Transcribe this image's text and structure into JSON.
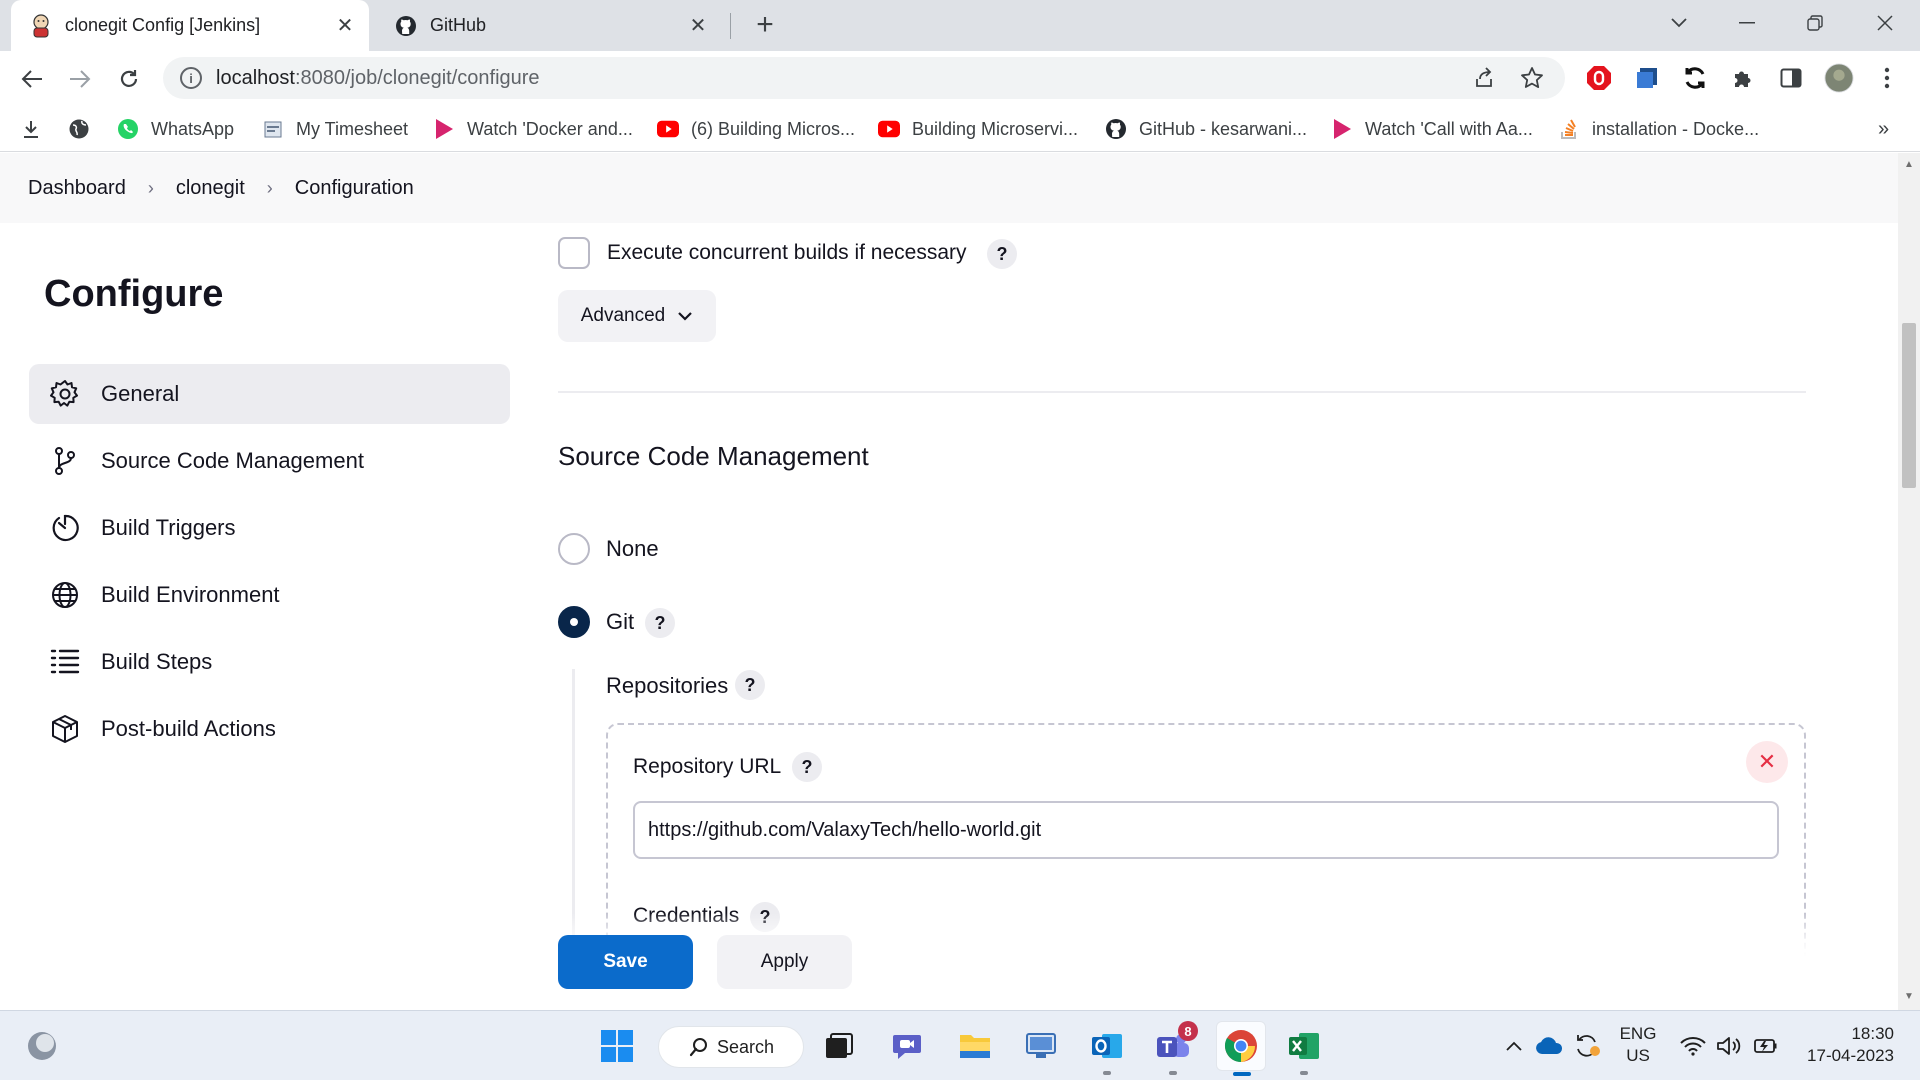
{
  "browser": {
    "tabs": [
      {
        "title": "clonegit Config [Jenkins]",
        "close": "✕"
      },
      {
        "title": "GitHub",
        "close": "✕"
      }
    ],
    "new_tab": "+",
    "url_host": "localhost",
    "url_path": ":8080/job/clonegit/configure",
    "bookmarks": [
      "WhatsApp",
      "My Timesheet",
      "Watch 'Docker and...",
      "(6) Building Micros...",
      "Building Microservi...",
      "GitHub - kesarwani...",
      "Watch 'Call with Aa...",
      "installation - Docke..."
    ],
    "more_bookmarks": "»"
  },
  "breadcrumb": {
    "items": [
      "Dashboard",
      "clonegit",
      "Configuration"
    ],
    "separator": "›"
  },
  "sidebar": {
    "title": "Configure",
    "items": [
      {
        "label": "General",
        "icon": "gear-icon"
      },
      {
        "label": "Source Code Management",
        "icon": "git-branch-icon"
      },
      {
        "label": "Build Triggers",
        "icon": "timer-icon"
      },
      {
        "label": "Build Environment",
        "icon": "globe-icon"
      },
      {
        "label": "Build Steps",
        "icon": "list-icon"
      },
      {
        "label": "Post-build Actions",
        "icon": "package-icon"
      }
    ]
  },
  "general": {
    "concurrent_label": "Execute concurrent builds if necessary",
    "concurrent_checked": false,
    "advanced_label": "Advanced",
    "help": "?"
  },
  "scm": {
    "title": "Source Code Management",
    "options": [
      {
        "label": "None",
        "selected": false
      },
      {
        "label": "Git",
        "selected": true
      }
    ],
    "repositories_label": "Repositories",
    "repository_url_label": "Repository URL",
    "repository_url_value": "https://github.com/ValaxyTech/hello-world.git",
    "credentials_label": "Credentials",
    "remove": "✕"
  },
  "actions": {
    "save": "Save",
    "apply": "Apply"
  },
  "taskbar": {
    "search_label": "Search",
    "teams_badge": "8",
    "lang_line1": "ENG",
    "lang_line2": "US",
    "time": "18:30",
    "date": "17-04-2023"
  },
  "colors": {
    "primary": "#0b6bcb",
    "radio_selected": "#09264a",
    "danger": "#e52f44"
  }
}
